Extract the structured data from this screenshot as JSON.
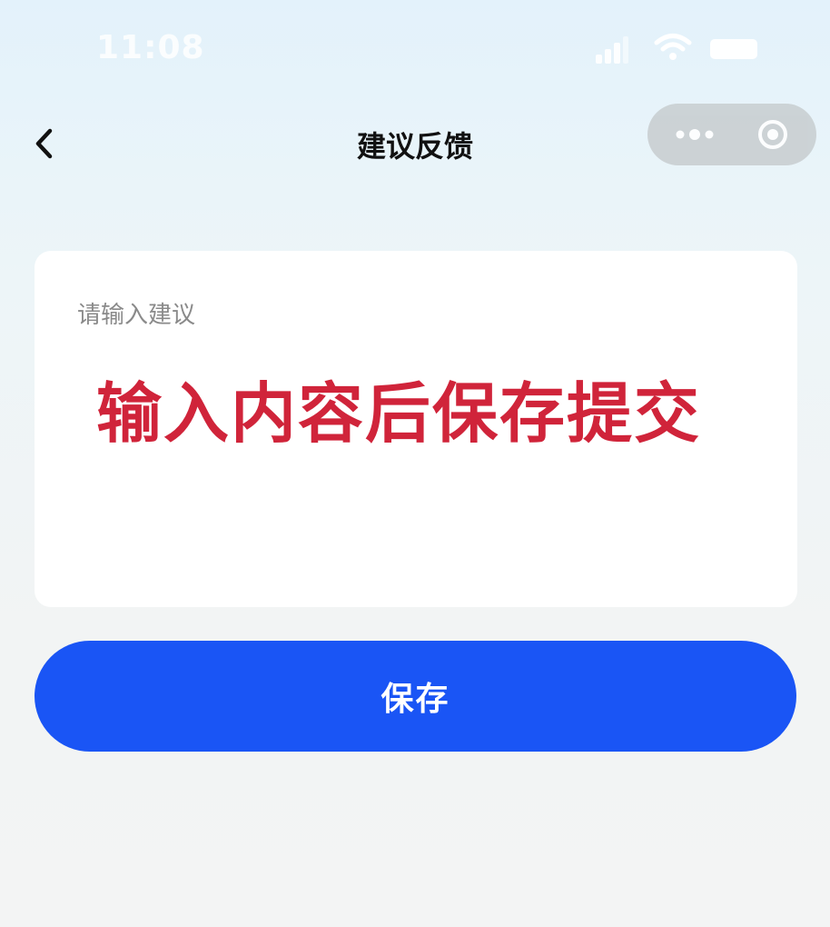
{
  "status_bar": {
    "time": "11:08"
  },
  "nav": {
    "title": "建议反馈",
    "back_icon": "chevron-left-icon",
    "capsule_icons": [
      "more-dots-icon",
      "close-target-icon"
    ]
  },
  "feedback": {
    "placeholder": "请输入建议",
    "value": "",
    "overlay_instruction": "输入内容后保存提交"
  },
  "actions": {
    "save_label": "保存"
  },
  "colors": {
    "primary": "#1a55f5",
    "annotation": "#d0243a",
    "card_bg": "#ffffff",
    "capsule_bg": "#c9cfd2"
  }
}
